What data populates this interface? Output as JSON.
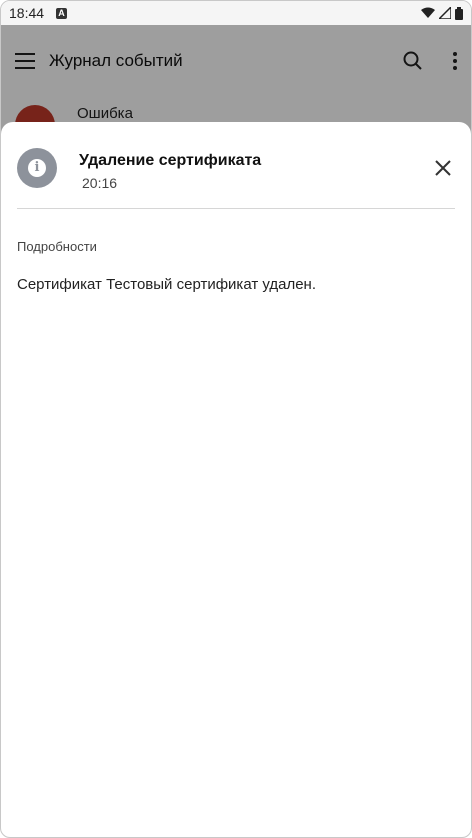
{
  "status_bar": {
    "time": "18:44",
    "notification_glyph": "A",
    "icons": [
      "wifi-icon",
      "signal-icon",
      "battery-icon"
    ]
  },
  "toolbar": {
    "title": "Журнал событий",
    "icons": [
      "menu-icon",
      "search-icon",
      "more-vert-icon"
    ]
  },
  "background_list": {
    "first_item_title": "Ошибка"
  },
  "sheet": {
    "title": "Удаление сертификата",
    "time": "20:16",
    "section_label": "Подробности",
    "details": "Сертификат Тестовый сертификат удален.",
    "icon": "info-icon",
    "icon_color": "#8d929b"
  },
  "colors": {
    "scrim": "rgba(0,0,0,0.38)",
    "error_avatar": "#c0392b"
  }
}
